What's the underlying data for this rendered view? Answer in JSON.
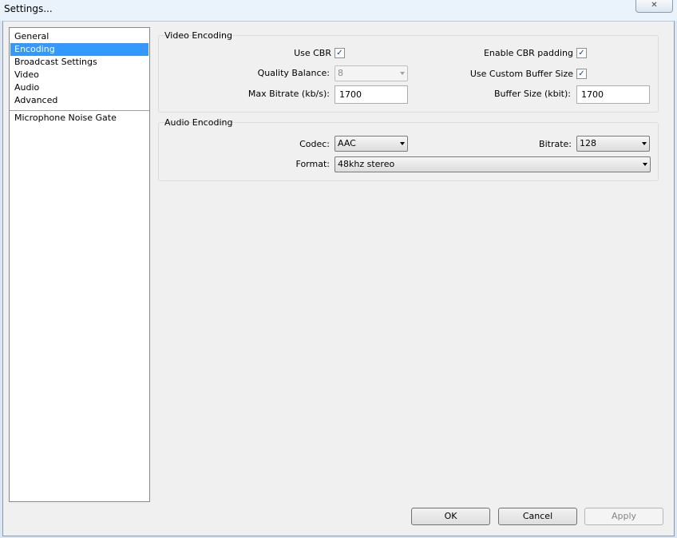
{
  "window": {
    "title": "Settings...",
    "close_glyph": "✕"
  },
  "sidebar": {
    "items": [
      {
        "label": "General"
      },
      {
        "label": "Encoding"
      },
      {
        "label": "Broadcast Settings"
      },
      {
        "label": "Video"
      },
      {
        "label": "Audio"
      },
      {
        "label": "Advanced"
      },
      {
        "label": "Microphone Noise Gate"
      }
    ],
    "selected": "Encoding"
  },
  "video_encoding": {
    "title": "Video Encoding",
    "use_cbr": {
      "label": "Use CBR",
      "checked": true
    },
    "enable_cbr_padding": {
      "label": "Enable CBR padding",
      "checked": true
    },
    "quality_balance": {
      "label": "Quality Balance:",
      "value": "8",
      "enabled": false
    },
    "use_custom_buffer_size": {
      "label": "Use Custom Buffer Size",
      "checked": true
    },
    "max_bitrate": {
      "label": "Max Bitrate (kb/s):",
      "value": "1700"
    },
    "buffer_size": {
      "label": "Buffer Size (kbit):",
      "value": "1700"
    }
  },
  "audio_encoding": {
    "title": "Audio Encoding",
    "codec": {
      "label": "Codec:",
      "value": "AAC"
    },
    "bitrate": {
      "label": "Bitrate:",
      "value": "128"
    },
    "format": {
      "label": "Format:",
      "value": "48khz stereo"
    }
  },
  "buttons": {
    "ok": "OK",
    "cancel": "Cancel",
    "apply": "Apply"
  },
  "check_glyph": "✓"
}
